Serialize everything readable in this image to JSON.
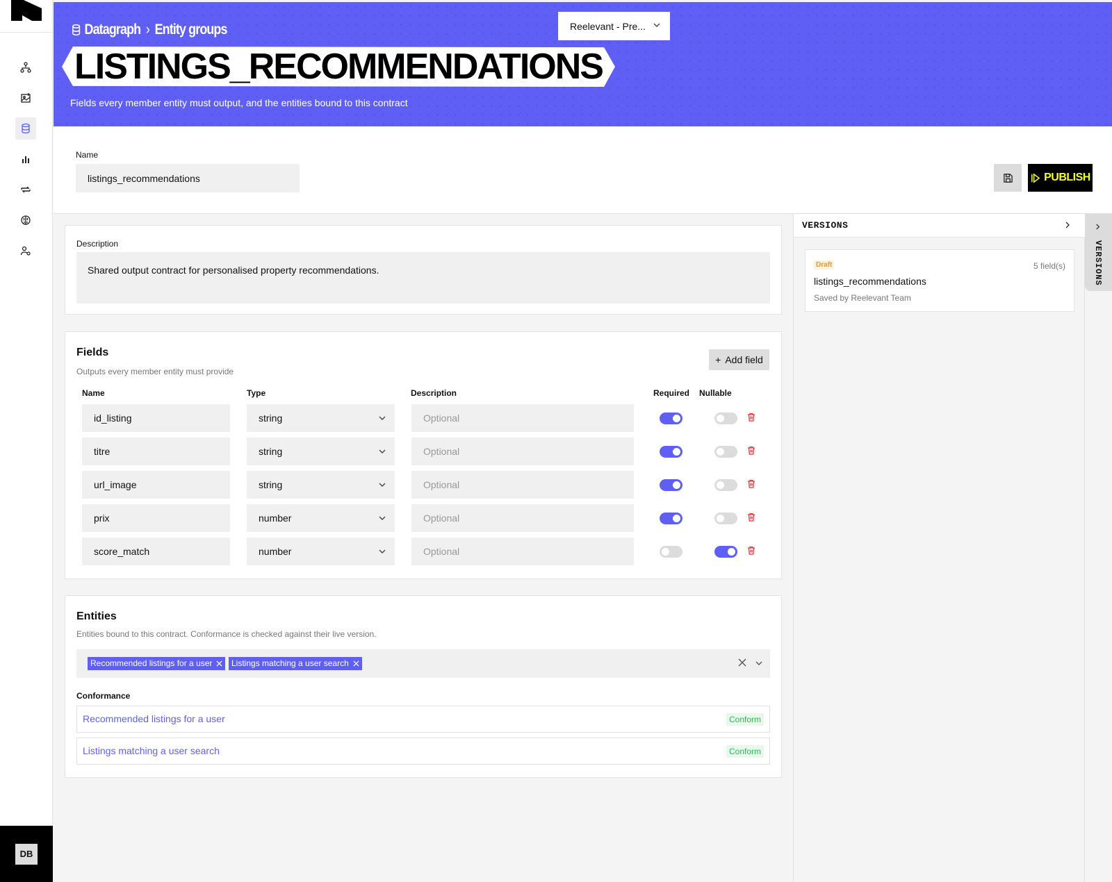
{
  "workspace": {
    "selected": "Reelevant - Pre..."
  },
  "breadcrumb": {
    "root": "Datagraph",
    "current": "Entity groups"
  },
  "page": {
    "title": "LISTINGS_RECOMMENDATIONS",
    "subtitle": "Fields every member entity must output, and the entities bound to this contract"
  },
  "name_field": {
    "label": "Name",
    "value": "listings_recommendations"
  },
  "actions": {
    "publish_label": "PUBLISH"
  },
  "description": {
    "label": "Description",
    "value": "Shared output contract for personalised property recommendations."
  },
  "fields_section": {
    "title": "Fields",
    "subtitle": "Outputs every member entity must provide",
    "add_label": "Add field",
    "columns": {
      "name": "Name",
      "type": "Type",
      "description": "Description",
      "required": "Required",
      "nullable": "Nullable"
    },
    "rows": [
      {
        "name": "id_listing",
        "type": "string",
        "description_placeholder": "Optional",
        "required": true,
        "nullable": false
      },
      {
        "name": "titre",
        "type": "string",
        "description_placeholder": "Optional",
        "required": true,
        "nullable": false
      },
      {
        "name": "url_image",
        "type": "string",
        "description_placeholder": "Optional",
        "required": true,
        "nullable": false
      },
      {
        "name": "prix",
        "type": "number",
        "description_placeholder": "Optional",
        "required": true,
        "nullable": false
      },
      {
        "name": "score_match",
        "type": "number",
        "description_placeholder": "Optional",
        "required": false,
        "nullable": true
      }
    ]
  },
  "entities_section": {
    "title": "Entities",
    "subtitle": "Entities bound to this contract. Conformance is checked against their live version.",
    "chips": [
      "Recommended listings for a user",
      "Listings matching a user search"
    ],
    "conformance_label": "Conformance",
    "conformance": [
      {
        "entity": "Recommended listings for a user",
        "status": "Conform"
      },
      {
        "entity": "Listings matching a user search",
        "status": "Conform"
      }
    ]
  },
  "versions": {
    "title": "VERSIONS",
    "tab_label": "VERSIONS",
    "items": [
      {
        "status": "Draft",
        "field_count": "5 field(s)",
        "name": "listings_recommendations",
        "saved_by": "Saved by Reelevant Team"
      }
    ]
  },
  "user": {
    "initials": "DB"
  },
  "colors": {
    "accent": "#5f5ff6",
    "publish_text": "#f5ff2a",
    "delete": "#e5343f",
    "conform": "#2eb84f",
    "draft": "#f0962b"
  },
  "icons": {
    "sidebar": [
      "org-chart-icon",
      "network-image-icon",
      "database-icon",
      "bar-chart-icon",
      "sync-arrows-icon",
      "brain-icon",
      "user-settings-icon"
    ]
  }
}
